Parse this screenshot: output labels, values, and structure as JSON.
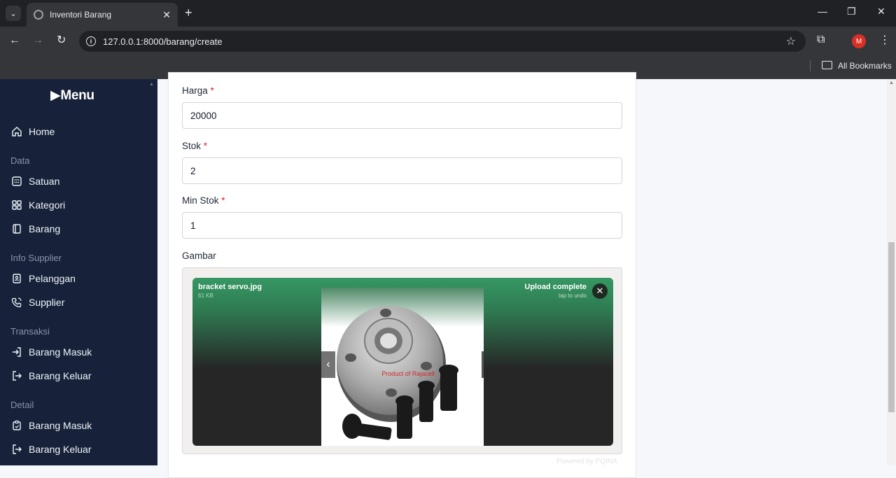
{
  "browser": {
    "tab_title": "Inventori Barang",
    "url": "127.0.0.1:8000/barang/create",
    "profile_initial": "M",
    "bookmarks_label": "All Bookmarks"
  },
  "sidebar": {
    "brand": "Menu",
    "home": "Home",
    "sections": {
      "data": "Data",
      "info_supplier": "Info Supplier",
      "transaksi": "Transaksi",
      "detail": "Detail"
    },
    "items": {
      "satuan": "Satuan",
      "kategori": "Kategori",
      "barang": "Barang",
      "pelanggan": "Pelanggan",
      "supplier": "Supplier",
      "barang_masuk": "Barang Masuk",
      "barang_keluar": "Barang Keluar",
      "detail_barang_masuk": "Barang Masuk",
      "detail_barang_keluar": "Barang Keluar"
    }
  },
  "form": {
    "harga": {
      "label": "Harga",
      "required_mark": "*",
      "value": "20000"
    },
    "stok": {
      "label": "Stok",
      "required_mark": "*",
      "value": "2"
    },
    "min_stok": {
      "label": "Min Stok",
      "required_mark": "*",
      "value": "1"
    },
    "gambar": {
      "label": "Gambar"
    }
  },
  "upload": {
    "file_name": "bracket servo.jpg",
    "file_size": "61 KB",
    "status": "Upload complete",
    "undo_hint": "tap to undo",
    "image_watermark": "Product of Rajacell",
    "powered_by": "Powered by PQINA"
  },
  "colors": {
    "sidebar_bg": "#17223a",
    "upload_success": "#369763",
    "required": "#dc2626"
  }
}
